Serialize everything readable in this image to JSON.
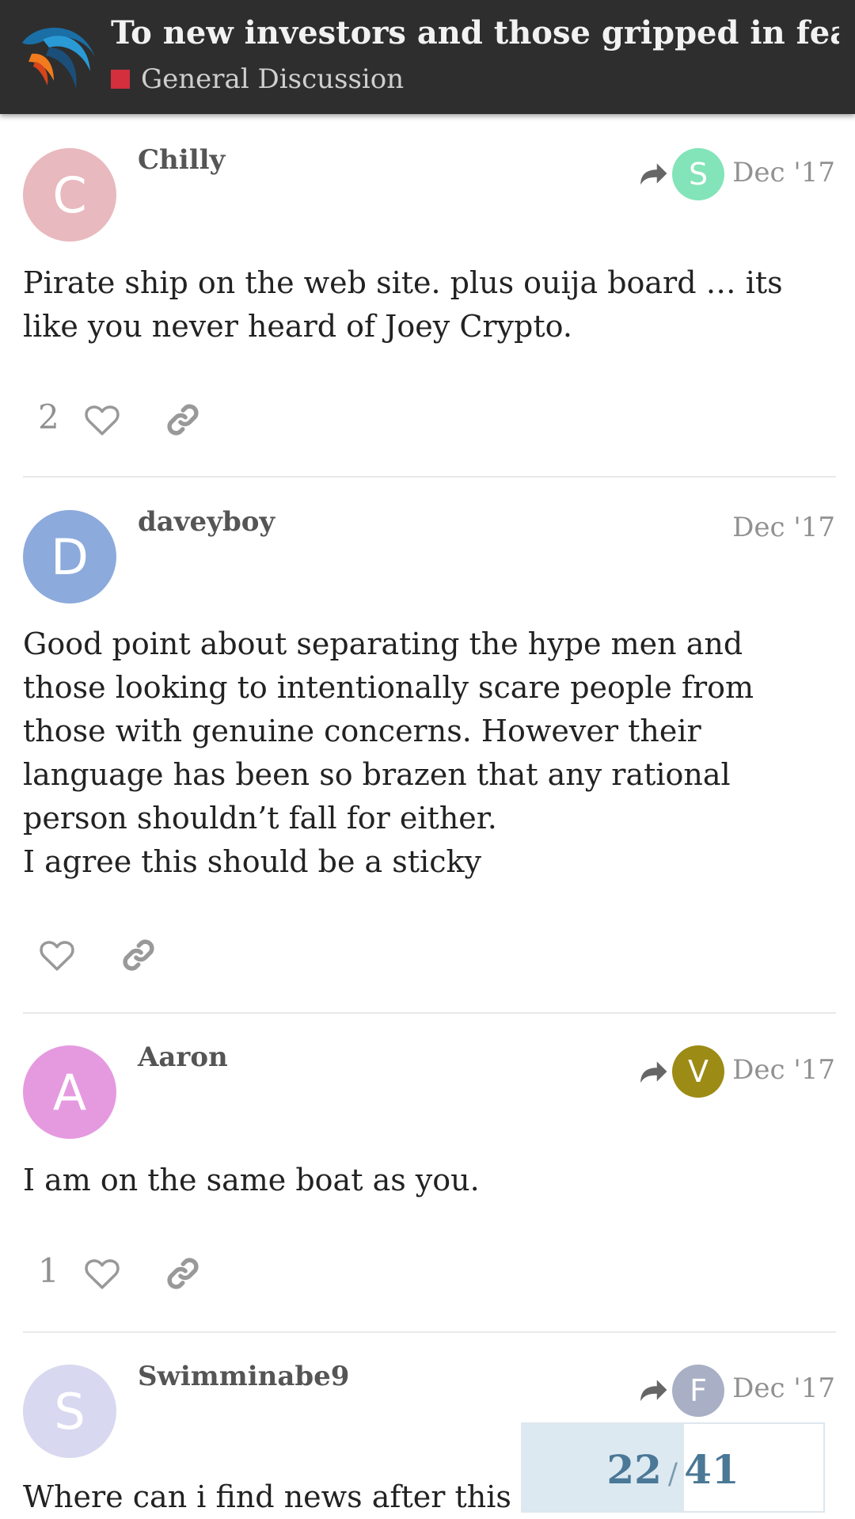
{
  "header": {
    "title": "To new investors and those gripped in fear",
    "category": "General Discussion",
    "category_color": "#d32f3c",
    "logo_icon": "site-logo-bird"
  },
  "posts": [
    {
      "username": "Chilly",
      "avatar_letter": "C",
      "avatar_color": "#e8b9be",
      "reply_to_letter": "S",
      "reply_to_color": "#82e4b8",
      "date": "Dec '17",
      "body": [
        "Pirate ship on the web site. plus ouija board … its like you never heard of Joey Crypto."
      ],
      "likes": "2"
    },
    {
      "username": "daveyboy",
      "avatar_letter": "D",
      "avatar_color": "#8caadc",
      "date": "Dec '17",
      "body": [
        "Good point about separating the hype men and those looking to intentionally scare people from those with genuine concerns. However their language has been so brazen that any rational person shouldn’t fall for either.",
        "I agree this should be a sticky"
      ]
    },
    {
      "username": "Aaron",
      "avatar_letter": "A",
      "avatar_color": "#e59ae0",
      "reply_to_letter": "V",
      "reply_to_color": "#9c8b15",
      "date": "Dec '17",
      "body": [
        "I am on the same boat as you."
      ],
      "likes": "1"
    },
    {
      "username": "Swimminabe9",
      "avatar_letter": "S",
      "avatar_color": "#d8d8f0",
      "reply_to_letter": "F",
      "reply_to_color": "#a9afc4",
      "date": "Dec '17",
      "body": [
        "Where can i find news after this a"
      ]
    }
  ],
  "icons": {
    "like": "heart-outline-icon",
    "share": "link-icon",
    "reply_to": "reply-arrow-icon"
  },
  "progress": {
    "current": "22",
    "separator": "/",
    "total": "41",
    "fraction": 0.537
  }
}
